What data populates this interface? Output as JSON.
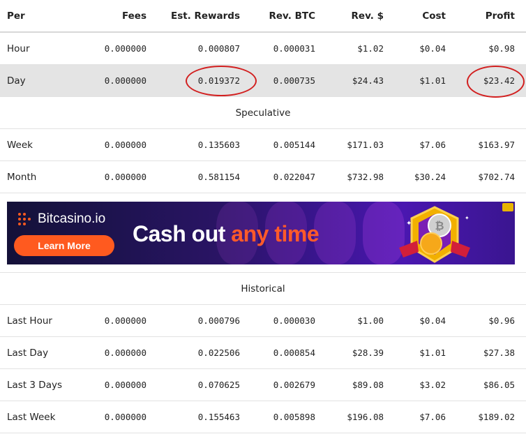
{
  "columns": [
    "Per",
    "Fees",
    "Est. Rewards",
    "Rev. BTC",
    "Rev. $",
    "Cost",
    "Profit"
  ],
  "current_rows": [
    {
      "per": "Hour",
      "fees": "0.000000",
      "est": "0.000807",
      "btc": "0.000031",
      "usd": "$1.02",
      "cost": "$0.04",
      "profit": "$0.98"
    },
    {
      "per": "Day",
      "fees": "0.000000",
      "est": "0.019372",
      "btc": "0.000735",
      "usd": "$24.43",
      "cost": "$1.01",
      "profit": "$23.42"
    }
  ],
  "speculative_label": "Speculative",
  "speculative_rows": [
    {
      "per": "Week",
      "fees": "0.000000",
      "est": "0.135603",
      "btc": "0.005144",
      "usd": "$171.03",
      "cost": "$7.06",
      "profit": "$163.97"
    },
    {
      "per": "Month",
      "fees": "0.000000",
      "est": "0.581154",
      "btc": "0.022047",
      "usd": "$732.98",
      "cost": "$30.24",
      "profit": "$702.74"
    }
  ],
  "ad": {
    "brand": "Bitcasino.io",
    "button": "Learn More",
    "headline_main": "Cash out ",
    "headline_accent": "any time",
    "accent_color": "#ff5a1f"
  },
  "historical_label": "Historical",
  "historical_rows": [
    {
      "per": "Last Hour",
      "fees": "0.000000",
      "est": "0.000796",
      "btc": "0.000030",
      "usd": "$1.00",
      "cost": "$0.04",
      "profit": "$0.96"
    },
    {
      "per": "Last Day",
      "fees": "0.000000",
      "est": "0.022506",
      "btc": "0.000854",
      "usd": "$28.39",
      "cost": "$1.01",
      "profit": "$27.38"
    },
    {
      "per": "Last 3 Days",
      "fees": "0.000000",
      "est": "0.070625",
      "btc": "0.002679",
      "usd": "$89.08",
      "cost": "$3.02",
      "profit": "$86.05"
    },
    {
      "per": "Last Week",
      "fees": "0.000000",
      "est": "0.155463",
      "btc": "0.005898",
      "usd": "$196.08",
      "cost": "$7.06",
      "profit": "$189.02"
    }
  ]
}
